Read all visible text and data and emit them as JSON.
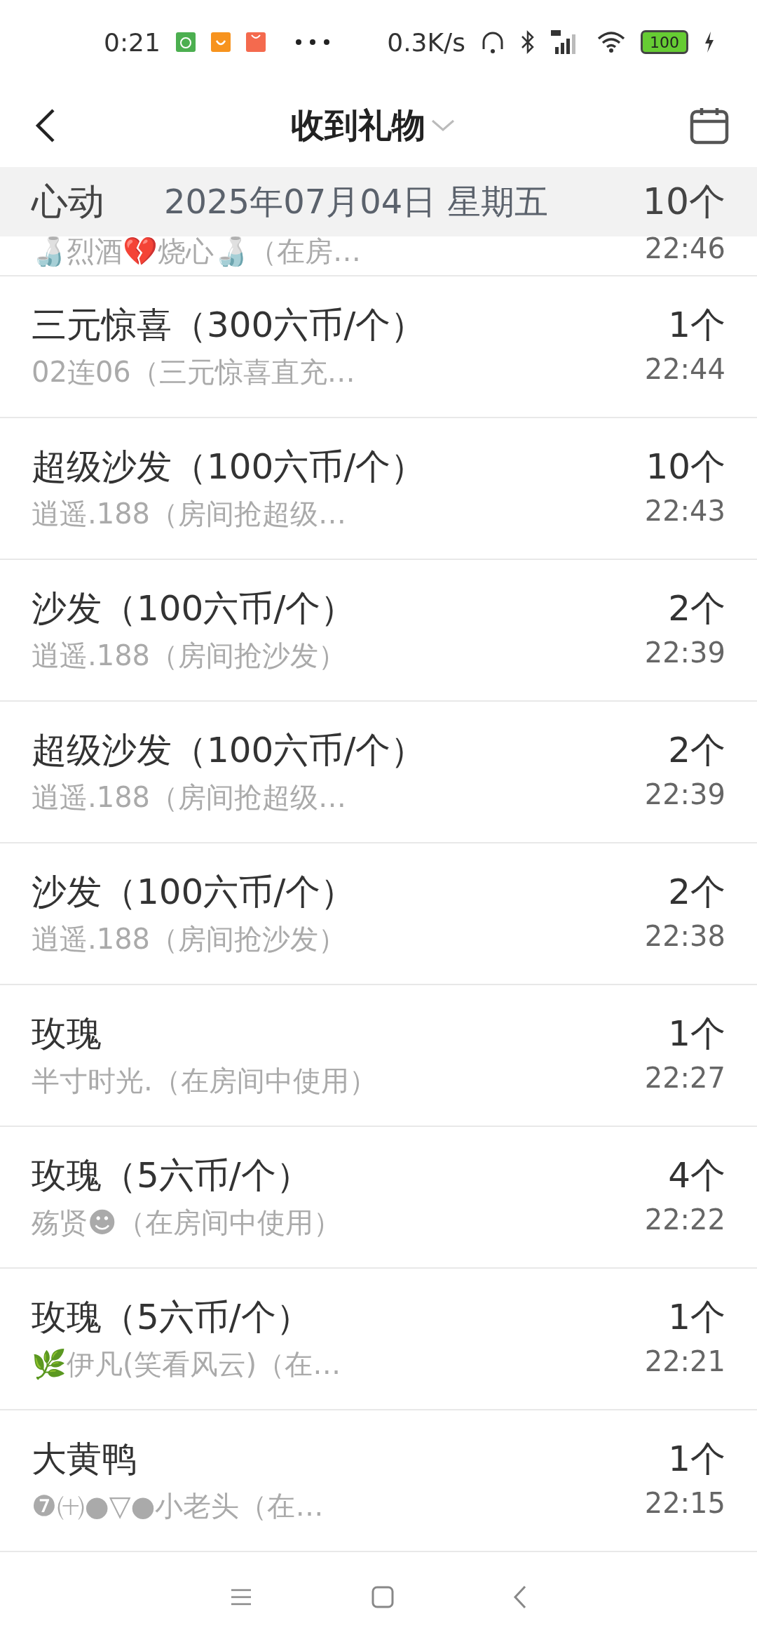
{
  "status_bar": {
    "time": "0:21",
    "net_speed": "0.3K/s",
    "battery": "100"
  },
  "header": {
    "title": "收到礼物"
  },
  "pinned": {
    "name": "心动",
    "date": "2025年07月04日 星期五",
    "count": "10个",
    "sender": "🍶烈酒💔烧心🍶（在房…",
    "time": "22:46"
  },
  "gifts": [
    {
      "name": "三元惊喜（300六币/个）",
      "sender": "02连06（三元惊喜直充…",
      "count": "1个",
      "time": "22:44"
    },
    {
      "name": "超级沙发（100六币/个）",
      "sender": "逍遥.188（房间抢超级…",
      "count": "10个",
      "time": "22:43"
    },
    {
      "name": "沙发（100六币/个）",
      "sender": "逍遥.188（房间抢沙发）",
      "count": "2个",
      "time": "22:39"
    },
    {
      "name": "超级沙发（100六币/个）",
      "sender": "逍遥.188（房间抢超级…",
      "count": "2个",
      "time": "22:39"
    },
    {
      "name": "沙发（100六币/个）",
      "sender": "逍遥.188（房间抢沙发）",
      "count": "2个",
      "time": "22:38"
    },
    {
      "name": "玫瑰",
      "sender": "半寸时光.（在房间中使用）",
      "count": "1个",
      "time": "22:27"
    },
    {
      "name": "玫瑰（5六币/个）",
      "sender": "殇贤☻（在房间中使用）",
      "count": "4个",
      "time": "22:22"
    },
    {
      "name": "玫瑰（5六币/个）",
      "sender": "🌿伊凡(笑看风云)（在…",
      "count": "1个",
      "time": "22:21"
    },
    {
      "name": "大黄鸭",
      "sender": "❼㈩●▽●小老头（在…",
      "count": "1个",
      "time": "22:15"
    }
  ]
}
